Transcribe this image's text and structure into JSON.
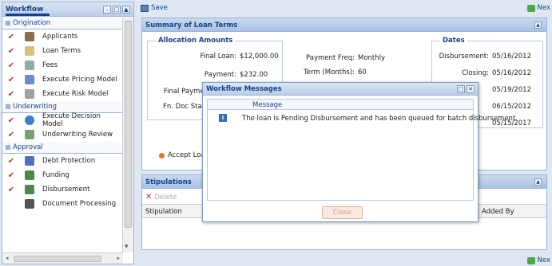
{
  "workflow": {
    "title": "Workflow",
    "controls": [
      "–",
      "□",
      "▲"
    ],
    "sections": [
      {
        "name": "Origination",
        "tasks": [
          {
            "label": "Applicants",
            "done": true,
            "icon": "applicants-icon",
            "color": "#8b6f47"
          },
          {
            "label": "Loan Terms",
            "done": true,
            "icon": "loan-terms-icon",
            "color": "#d9c07a"
          },
          {
            "label": "Fees",
            "done": true,
            "icon": "fees-icon",
            "color": "#8fb0a0"
          },
          {
            "label": "Execute Pricing Model",
            "done": true,
            "icon": "pricing-model-icon",
            "color": "#6a8fd0"
          },
          {
            "label": "Execute Risk Model",
            "done": true,
            "icon": "risk-model-icon",
            "color": "#a0a0a0"
          }
        ]
      },
      {
        "name": "Underwriting",
        "tasks": [
          {
            "label": "Execute Decision Model",
            "done": true,
            "icon": "decision-model-icon",
            "color": "#3a7fd0"
          },
          {
            "label": "Underwriting Review",
            "done": true,
            "icon": "underwriting-review-icon",
            "color": "#7aa070"
          }
        ]
      },
      {
        "name": "Approval",
        "tasks": [
          {
            "label": "Debt Protection",
            "done": true,
            "icon": "debt-protection-icon",
            "color": "#5070c0"
          },
          {
            "label": "Funding",
            "done": true,
            "icon": "funding-icon",
            "color": "#4a8a4a"
          },
          {
            "label": "Disbursement",
            "done": true,
            "icon": "disbursement-icon",
            "color": "#4a8a4a"
          },
          {
            "label": "Document Processing",
            "done": false,
            "icon": "document-processing-icon",
            "color": "#555555"
          }
        ]
      }
    ]
  },
  "toolbar": {
    "save_label": "Save",
    "next_label": "Nex"
  },
  "summary": {
    "title": "Summary of Loan Terms",
    "allocation": {
      "legend": "Allocation Amounts",
      "rows": [
        {
          "k": "Final Loan:",
          "v": "$12,000.00"
        },
        {
          "k": "Payment:",
          "v": "$232.00"
        },
        {
          "k": "Final Paymen",
          "v": ""
        },
        {
          "k": "Fn. Doc Stam",
          "v": ""
        }
      ]
    },
    "middle": [
      {
        "k": "Payment Freq:",
        "v": "Monthly"
      },
      {
        "k": "Term (Months):",
        "v": "60"
      }
    ],
    "dates": {
      "legend": "Dates",
      "rows": [
        {
          "k": "Disbursement:",
          "v": "05/16/2012"
        },
        {
          "k": "Closing:",
          "v": "05/16/2012"
        },
        {
          "k": "",
          "v": "05/19/2012"
        },
        {
          "k": "",
          "v": "06/15/2012"
        },
        {
          "k": "",
          "v": "05/15/2017"
        }
      ]
    },
    "accept_label": "Accept Loan"
  },
  "stipulations": {
    "title": "Stipulations",
    "delete_label": "Delete",
    "columns": [
      "Stipulation",
      "Added By"
    ]
  },
  "modal": {
    "title": "Workflow Messages",
    "column": "Message",
    "message": "The loan is Pending Disbursement and has been queued for batch disbursement.",
    "close_label": "Close"
  },
  "bottom": {
    "next_label": "Nex"
  }
}
